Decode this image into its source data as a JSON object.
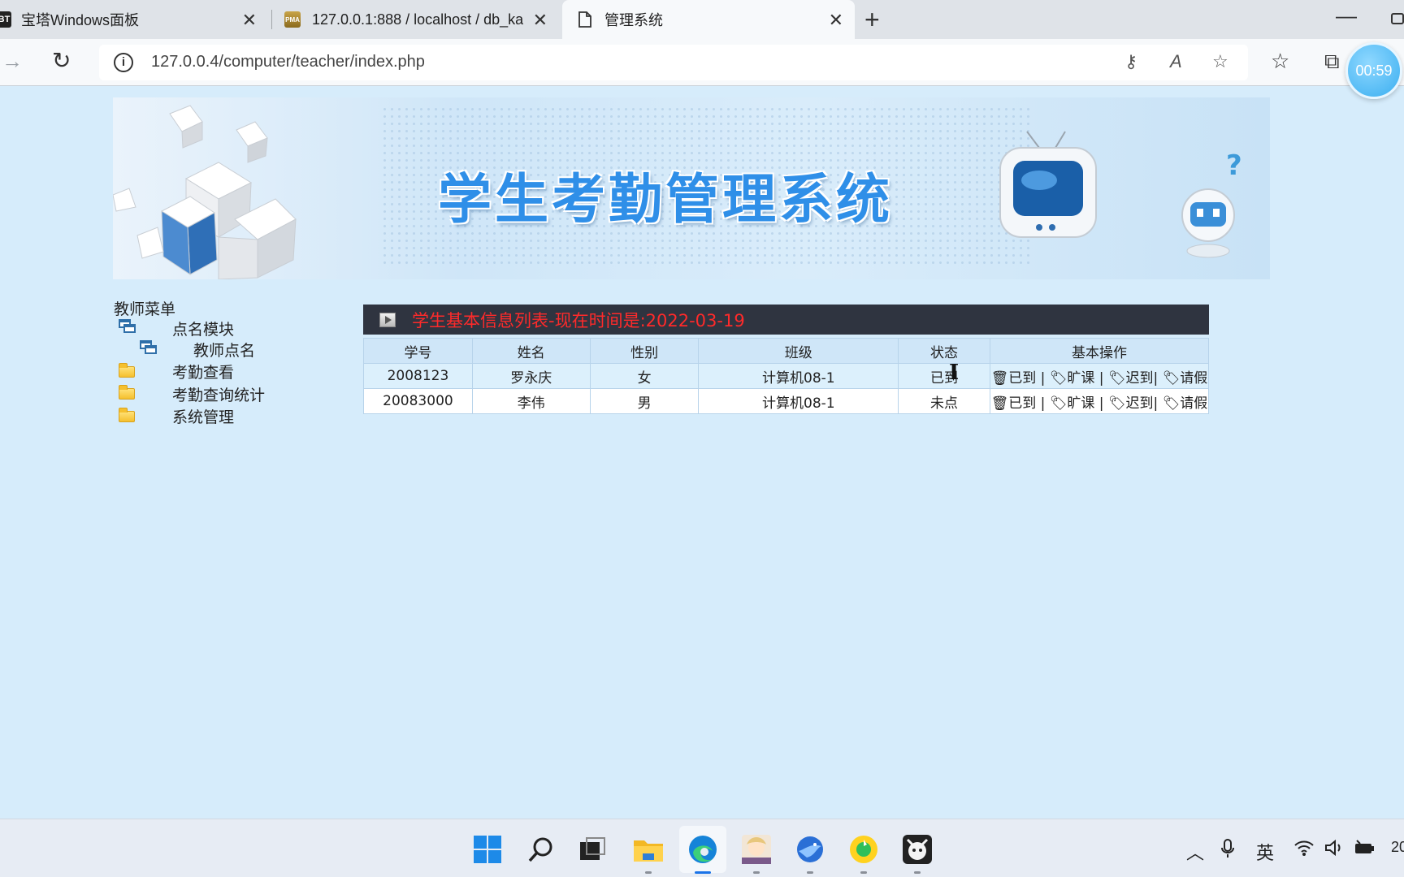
{
  "browser": {
    "tabs": [
      {
        "icon": "bt-logo-icon",
        "favicon_text": "BT",
        "title": "宝塔Windows面板"
      },
      {
        "icon": "phpmyadmin-icon",
        "favicon_text": "PMA",
        "title": "127.0.0.1:888 / localhost / db_ka"
      },
      {
        "icon": "page-icon",
        "title": "管理系统"
      }
    ],
    "address": "127.0.0.4/computer/teacher/index.php",
    "timer": "00:59"
  },
  "banner": {
    "title": "学生考勤管理系统"
  },
  "menu": {
    "heading": "教师菜单",
    "items": [
      {
        "label": "点名模块",
        "icon": "window-icon",
        "level": 1
      },
      {
        "label": "教师点名",
        "icon": "window-icon",
        "level": 2
      },
      {
        "label": "考勤查看",
        "icon": "folder-icon",
        "level": 1
      },
      {
        "label": "考勤查询统计",
        "icon": "folder-icon",
        "level": 1
      },
      {
        "label": "系统管理",
        "icon": "folder-icon",
        "level": 1
      }
    ]
  },
  "panel": {
    "title": "学生基本信息列表-现在时间是:2022-03-19",
    "columns": [
      "学号",
      "姓名",
      "性别",
      "班级",
      "状态",
      "基本操作"
    ],
    "rows": [
      {
        "id": "2008123",
        "name": "罗永庆",
        "gender": "女",
        "class": "计算机08-1",
        "status": "已到"
      },
      {
        "id": "20083000",
        "name": "李伟",
        "gender": "男",
        "class": "计算机08-1",
        "status": "未点"
      }
    ],
    "actions": {
      "present": "已到",
      "absent": "旷课",
      "late": "迟到",
      "leave": "请假",
      "present_icon": "🗑",
      "tag_icon": "🏷"
    }
  },
  "taskbar": {
    "apps": [
      "windows-start-icon",
      "search-icon",
      "task-view-icon",
      "file-explorer-icon",
      "edge-icon",
      "anime-app-icon",
      "blue-bird-app-icon",
      "music-app-icon",
      "game-app-icon"
    ],
    "ime": "英",
    "clock_partial": "20"
  }
}
